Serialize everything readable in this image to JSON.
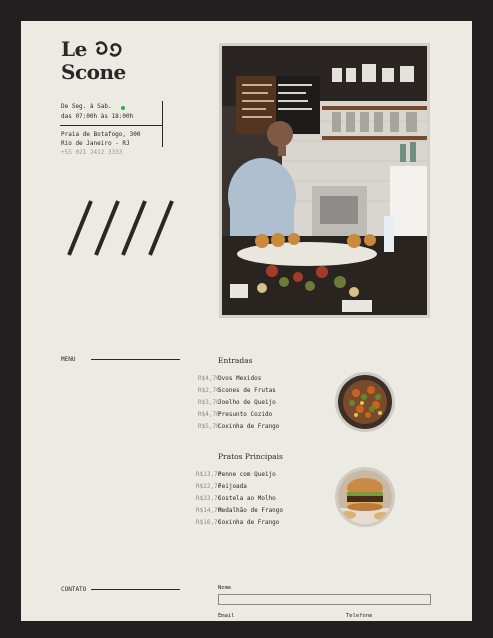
{
  "brand": {
    "name_line1": "Le",
    "name_line2": "Scone",
    "logo_icon": "scone-swirl-icon"
  },
  "hours": {
    "days": "De Seg. à Sab.",
    "time": "das 07:00h às 18:00h",
    "status_color": "#22b14c"
  },
  "address": {
    "street": "Praia de Botafogo, 300",
    "city": "Rio de Janeiro - RJ",
    "phone": "+55 021 2412 3333"
  },
  "decor": {
    "slashes_icon": "four-slashes-icon"
  },
  "hero_image": {
    "icon": "cafe-counter-photo"
  },
  "menu": {
    "label": "MENU",
    "categories": [
      {
        "title": "Entradas",
        "image_icon": "salad-dish-photo",
        "items": [
          {
            "price": "R$4,70",
            "name": "Ovos Mexidos"
          },
          {
            "price": "R$2,70",
            "name": "Scones de Frutas"
          },
          {
            "price": "R$3,70",
            "name": "Joelho de Queijo"
          },
          {
            "price": "R$4,70",
            "name": "Presunto Cozido"
          },
          {
            "price": "R$5,70",
            "name": "Coxinha de Frango"
          }
        ]
      },
      {
        "title": "Pratos Principais",
        "image_icon": "burger-photo",
        "items": [
          {
            "price": "R$13,70",
            "name": "Penne com Queijo"
          },
          {
            "price": "R$22,70",
            "name": "Feijoada"
          },
          {
            "price": "R$33,70",
            "name": "Costela ao Molho"
          },
          {
            "price": "R$14,70",
            "name": "Medalhão de Frango"
          },
          {
            "price": "R$16,70",
            "name": "Coxinha de Frango"
          }
        ]
      }
    ]
  },
  "contact": {
    "label": "CONTATO",
    "fields": {
      "name_label": "Nome",
      "email_label": "Email",
      "phone_label": "Telefone"
    }
  },
  "colors": {
    "ink": "#2b2627",
    "paper": "#ecebe3",
    "frame": "#231f20",
    "muted": "#8d8a83"
  }
}
